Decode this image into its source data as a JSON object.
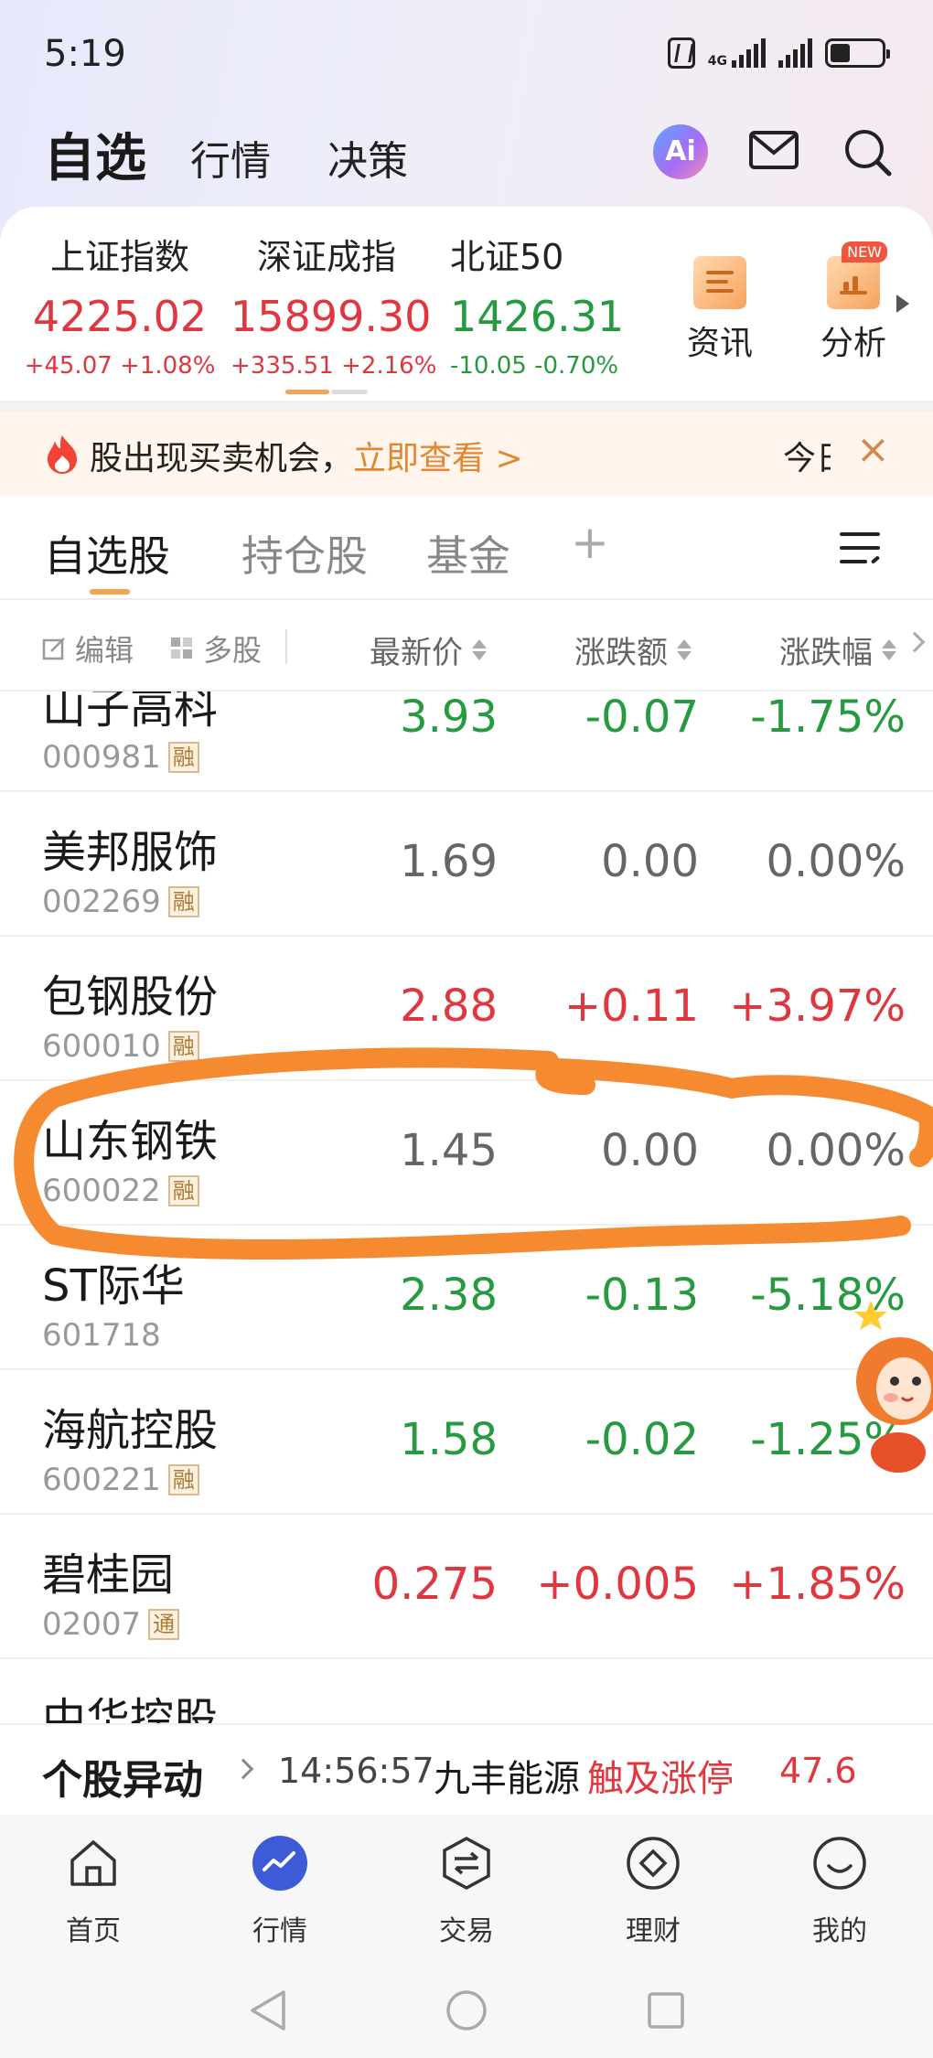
{
  "status_bar": {
    "time": "5:19",
    "network": "4G"
  },
  "header": {
    "tabs": [
      {
        "label": "自选",
        "active": true
      },
      {
        "label": "行情",
        "active": false
      },
      {
        "label": "决策",
        "active": false
      }
    ],
    "ai_label": "Ai",
    "icons": [
      "ai-assistant-icon",
      "mail-icon",
      "search-icon"
    ]
  },
  "indices": [
    {
      "name": "上证指数",
      "value": "4225.02",
      "change": "+45.07",
      "pct": "+1.08%",
      "direction": "up"
    },
    {
      "name": "深证成指",
      "value": "15899.30",
      "change": "+335.51",
      "pct": "+2.16%",
      "direction": "up"
    },
    {
      "name": "北证50",
      "value": "1426.31",
      "change": "-10.05",
      "pct": "-0.70%",
      "direction": "down"
    }
  ],
  "quick_links": [
    {
      "label": "资讯",
      "icon": "news-icon"
    },
    {
      "label": "分析",
      "icon": "analysis-icon",
      "badge": "NEW"
    }
  ],
  "banner": {
    "text": "股出现买卖机会，",
    "link": "立即查看 >",
    "next_text": "今日"
  },
  "subtabs": [
    {
      "label": "自选股",
      "active": true
    },
    {
      "label": "持仓股",
      "active": false
    },
    {
      "label": "基金",
      "active": false
    },
    {
      "label": "+",
      "active": false
    }
  ],
  "columns": {
    "edit_label": "编辑",
    "multi_label": "多股",
    "price": "最新价",
    "change": "涨跌额",
    "pct": "涨跌幅"
  },
  "stocks": [
    {
      "name": "山子高科",
      "code": "000981",
      "tag": "融",
      "price": "3.93",
      "change": "-0.07",
      "pct": "-1.75%",
      "direction": "down"
    },
    {
      "name": "美邦服饰",
      "code": "002269",
      "tag": "融",
      "price": "1.69",
      "change": "0.00",
      "pct": "0.00%",
      "direction": "flat"
    },
    {
      "name": "包钢股份",
      "code": "600010",
      "tag": "融",
      "price": "2.88",
      "change": "+0.11",
      "pct": "+3.97%",
      "direction": "up"
    },
    {
      "name": "山东钢铁",
      "code": "600022",
      "tag": "融",
      "price": "1.45",
      "change": "0.00",
      "pct": "0.00%",
      "direction": "flat",
      "circled": true
    },
    {
      "name": "ST际华",
      "code": "601718",
      "tag": "",
      "price": "2.38",
      "change": "-0.13",
      "pct": "-5.18%",
      "direction": "down"
    },
    {
      "name": "海航控股",
      "code": "600221",
      "tag": "融",
      "price": "1.58",
      "change": "-0.02",
      "pct": "-1.25%",
      "direction": "down"
    },
    {
      "name": "碧桂园",
      "code": "02007",
      "tag": "通",
      "price": "0.275",
      "change": "+0.005",
      "pct": "+1.85%",
      "direction": "up"
    },
    {
      "name": "中华控股",
      "code": "",
      "tag": "",
      "price": "",
      "change": "",
      "pct": "",
      "direction": "flat"
    }
  ],
  "ticker": {
    "title": "个股异动",
    "time": "14:56:57",
    "stock": "九丰能源",
    "event": "触及涨停",
    "value": "47.6"
  },
  "bottom_nav": [
    {
      "label": "首页",
      "icon": "home-icon",
      "active": false
    },
    {
      "label": "行情",
      "icon": "market-icon",
      "active": true
    },
    {
      "label": "交易",
      "icon": "trade-icon",
      "active": false
    },
    {
      "label": "理财",
      "icon": "wealth-icon",
      "active": false
    },
    {
      "label": "我的",
      "icon": "profile-icon",
      "active": false
    }
  ],
  "colors": {
    "up": "#e0363e",
    "down": "#259a3f",
    "flat": "#666666",
    "accent": "#f0a650",
    "annotation": "#f58a30"
  }
}
